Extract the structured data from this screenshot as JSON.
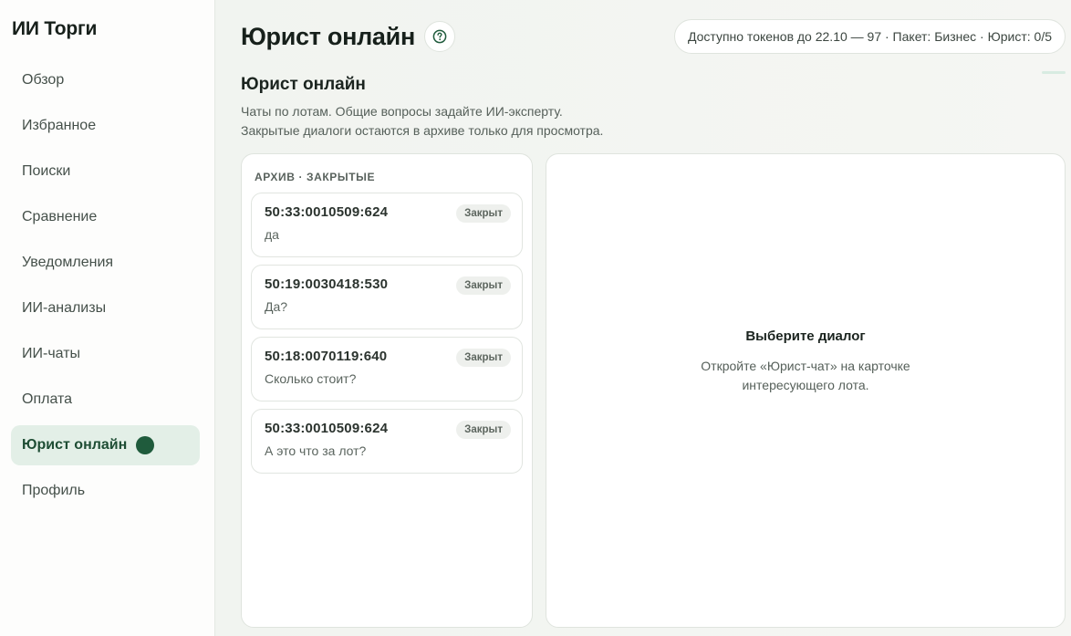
{
  "brand": "ИИ Торги",
  "nav": {
    "items": [
      {
        "label": "Обзор"
      },
      {
        "label": "Избранное"
      },
      {
        "label": "Поиски"
      },
      {
        "label": "Сравнение"
      },
      {
        "label": "Уведомления"
      },
      {
        "label": "ИИ-анализы"
      },
      {
        "label": "ИИ-чаты"
      },
      {
        "label": "Оплата"
      },
      {
        "label": "Юрист онлайн",
        "active": true
      },
      {
        "label": "Профиль"
      }
    ]
  },
  "header": {
    "title": "Юрист онлайн",
    "help_icon": "question-circle-icon",
    "tokens": "Доступно токенов до 22.10 — 97 · Пакет: Бизнес · Юрист: 0/5"
  },
  "section": {
    "title": "Юрист онлайн",
    "desc_line1": "Чаты по лотам. Общие вопросы задайте ИИ-эксперту.",
    "desc_line2": "Закрытые диалоги остаются в архиве только для просмотра."
  },
  "archive": {
    "heading": "Архив · закрытые",
    "chats": [
      {
        "id": "50:33:0010509:624",
        "preview": "да",
        "status": "Закрыт"
      },
      {
        "id": "50:19:0030418:530",
        "preview": "Да?",
        "status": "Закрыт"
      },
      {
        "id": "50:18:0070119:640",
        "preview": "Сколько стоит?",
        "status": "Закрыт"
      },
      {
        "id": "50:33:0010509:624",
        "preview": "А это что за лот?",
        "status": "Закрыт"
      }
    ]
  },
  "empty_state": {
    "title": "Выберите диалог",
    "desc": "Откройте «Юрист-чат» на карточке интересующего лота."
  },
  "colors": {
    "accent": "#1f5b3c",
    "active_bg": "#e3efe7"
  }
}
